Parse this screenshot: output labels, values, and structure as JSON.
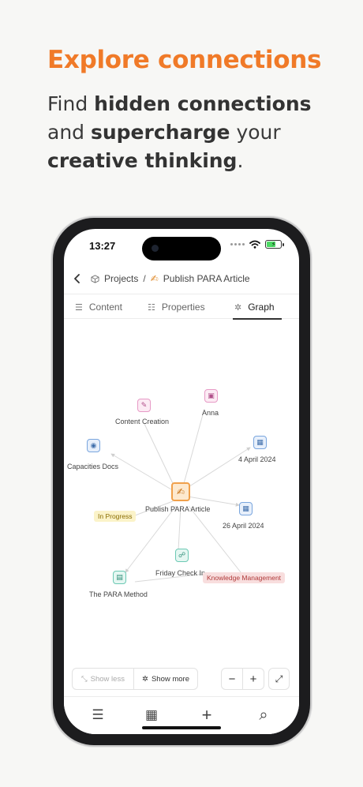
{
  "marketing": {
    "headline": "Explore connections",
    "sub_1": "Find ",
    "sub_2": "hidden connections",
    "sub_3": " and ",
    "sub_4": "supercharge",
    "sub_5": " your ",
    "sub_6": "creative thinking",
    "sub_7": "."
  },
  "status": {
    "time": "13:27",
    "bolt": "⚡"
  },
  "breadcrumb": {
    "parent": "Projects",
    "separator": "/",
    "page_emoji": "✍",
    "page": "Publish PARA Article"
  },
  "tabs": [
    {
      "label": "Content",
      "icon": "lines-icon",
      "glyph": "☰"
    },
    {
      "label": "Properties",
      "icon": "list-icon",
      "glyph": "☷"
    },
    {
      "label": "Graph",
      "icon": "graph-icon",
      "glyph": "✲"
    }
  ],
  "graph": {
    "center": {
      "label": "Publish PARA Article",
      "glyph": "✍"
    },
    "nodes": {
      "content_creation": {
        "label": "Content Creation",
        "glyph": "✎"
      },
      "anna": {
        "label": "Anna",
        "glyph": "▣"
      },
      "capacities_docs": {
        "label": "Capacities Docs",
        "glyph": "◉"
      },
      "april_4": {
        "label": "4 April 2024",
        "glyph": "▦"
      },
      "april_26": {
        "label": "26 April 2024",
        "glyph": "▦"
      },
      "friday_check_in": {
        "label": "Friday Check In",
        "glyph": "☍"
      },
      "para_method": {
        "label": "The PARA Method",
        "glyph": "▤"
      }
    },
    "tags": {
      "in_progress": "In Progress",
      "knowledge_management": "Knowledge Management"
    },
    "colors": {
      "center_border": "#f0a04b",
      "center_bg": "#fde9cf",
      "pink": "#e79ac6",
      "blue": "#7aa6de",
      "teal": "#6cc9b4",
      "tag_yellow_bg": "#fbf3c9",
      "tag_yellow_text": "#8a6d00",
      "tag_red_bg": "#f8dede",
      "tag_red_text": "#b03a3a",
      "edge": "#d4d4d4"
    }
  },
  "controls": {
    "show_less": "Show less",
    "show_more": "Show more",
    "zoom_out": "−",
    "zoom_in": "+",
    "fit": "⤢"
  },
  "bottom_bar": {
    "list_glyph": "☰",
    "calendar_glyph": "▦",
    "add_glyph": "+",
    "search_glyph": "⌕"
  }
}
